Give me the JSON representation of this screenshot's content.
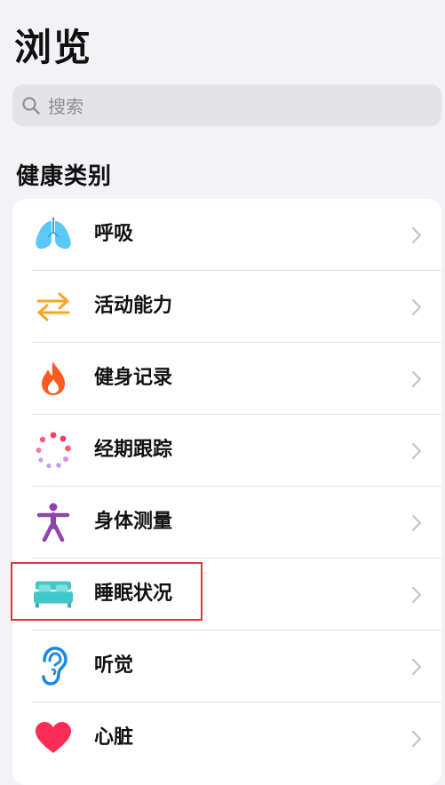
{
  "header": {
    "title": "浏览"
  },
  "search": {
    "placeholder": "搜索",
    "icon": "search-icon"
  },
  "section": {
    "title": "健康类别"
  },
  "categories": [
    {
      "label": "呼吸",
      "icon": "lungs-icon",
      "color": "#5ac8fa"
    },
    {
      "label": "活动能力",
      "icon": "arrows-icon",
      "color": "#f5a623"
    },
    {
      "label": "健身记录",
      "icon": "flame-icon",
      "color": "#ff5a1f"
    },
    {
      "label": "经期跟踪",
      "icon": "cycle-dots-icon",
      "color": "#ff5a7a"
    },
    {
      "label": "身体测量",
      "icon": "figure-icon",
      "color": "#8e44ad"
    },
    {
      "label": "睡眠状况",
      "icon": "bed-icon",
      "color": "#40c8c8"
    },
    {
      "label": "听觉",
      "icon": "ear-icon",
      "color": "#1e88e5"
    },
    {
      "label": "心脏",
      "icon": "heart-icon",
      "color": "#ff2d55"
    }
  ],
  "highlight_color": "#d9393b"
}
